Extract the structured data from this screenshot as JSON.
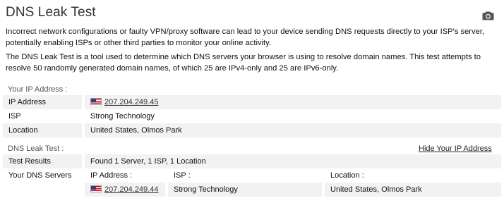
{
  "title": "DNS Leak Test",
  "icons": {
    "screenshot": "camera-icon",
    "flag": "us-flag-icon"
  },
  "intro": [
    "Incorrect network configurations or faulty VPN/proxy software can lead to your device sending DNS requests directly to your ISP's server, potentially enabling ISPs or other third parties to monitor your online activity.",
    "The DNS Leak Test is a tool used to determine which DNS servers your browser is using to resolve domain names. This test attempts to resolve 50 randomly generated domain names, of which 25 are IPv4-only and 25 are IPv6-only."
  ],
  "ip_section": {
    "label": "Your IP Address :",
    "rows": [
      {
        "key": "IP Address",
        "value": "207.204.249.45"
      },
      {
        "key": "ISP",
        "value": "Strong Technology"
      },
      {
        "key": "Location",
        "value": "United States, Olmos Park"
      }
    ]
  },
  "dns_section": {
    "label": "DNS Leak Test :",
    "hide_link": "Hide Your IP Address",
    "results_key": "Test Results",
    "results_value": "Found 1 Server, 1 ISP, 1 Location",
    "servers_key": "Your DNS Servers",
    "columns": [
      "IP Address :",
      "ISP :",
      "Location :"
    ],
    "servers": [
      {
        "ip": "207.204.249.44",
        "isp": "Strong Technology",
        "location": "United States, Olmos Park"
      }
    ]
  }
}
